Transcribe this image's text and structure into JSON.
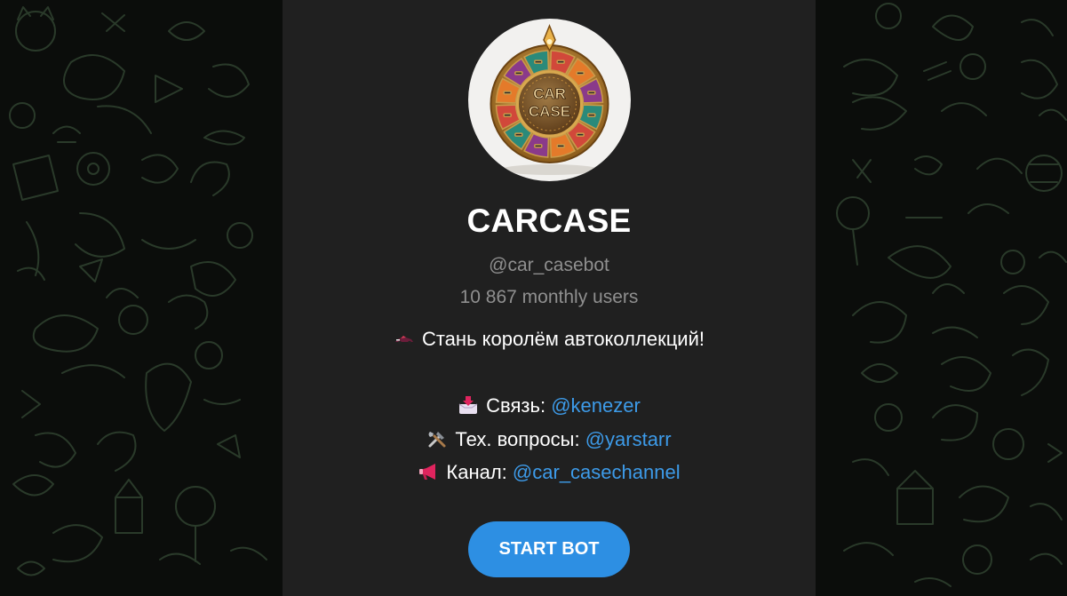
{
  "bot": {
    "name": "CARCASE",
    "username": "@car_casebot",
    "monthly_users": "10 867 monthly users",
    "avatar_label_top": "CAR",
    "avatar_label_bottom": "CASE"
  },
  "description": {
    "tagline": "Стань королём автоколлекций!",
    "contact_label": "Связь:",
    "contact_link": "@kenezer",
    "support_label": "Тех. вопросы:",
    "support_link": "@yarstarr",
    "channel_label": "Канал:",
    "channel_link": "@car_casechannel"
  },
  "actions": {
    "start_label": "START BOT"
  },
  "icons": {
    "tagline": "race-car-icon",
    "contact": "inbox-tray-icon",
    "support": "hammer-and-wrench-icon",
    "channel": "megaphone-icon"
  },
  "colors": {
    "card_bg": "#202020",
    "page_bg": "#0b0d0b",
    "link": "#3d9be9",
    "button": "#2d8fe3",
    "muted_text": "#8f8f8f"
  }
}
